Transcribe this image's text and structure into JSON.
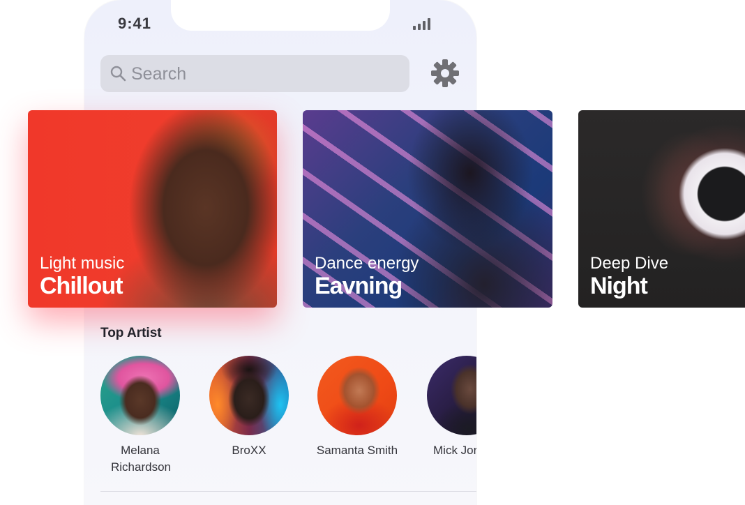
{
  "status_bar": {
    "time": "9:41"
  },
  "search": {
    "placeholder": "Search"
  },
  "cards": [
    {
      "subtitle": "Light music",
      "title": "Chillout"
    },
    {
      "subtitle": "Dance energy",
      "title": "Eavning"
    },
    {
      "subtitle": "Deep Dive",
      "title": "Night"
    }
  ],
  "top_artist": {
    "title": "Top Artist",
    "artists": [
      {
        "name": "Melana Richardson"
      },
      {
        "name": "BroXX"
      },
      {
        "name": "Samanta Smith"
      },
      {
        "name": "Mick Jor"
      }
    ]
  },
  "colors": {
    "accent_glow": "#ff4658",
    "search_bg": "#dcdde5",
    "phone_bg": "#eef0fb"
  }
}
